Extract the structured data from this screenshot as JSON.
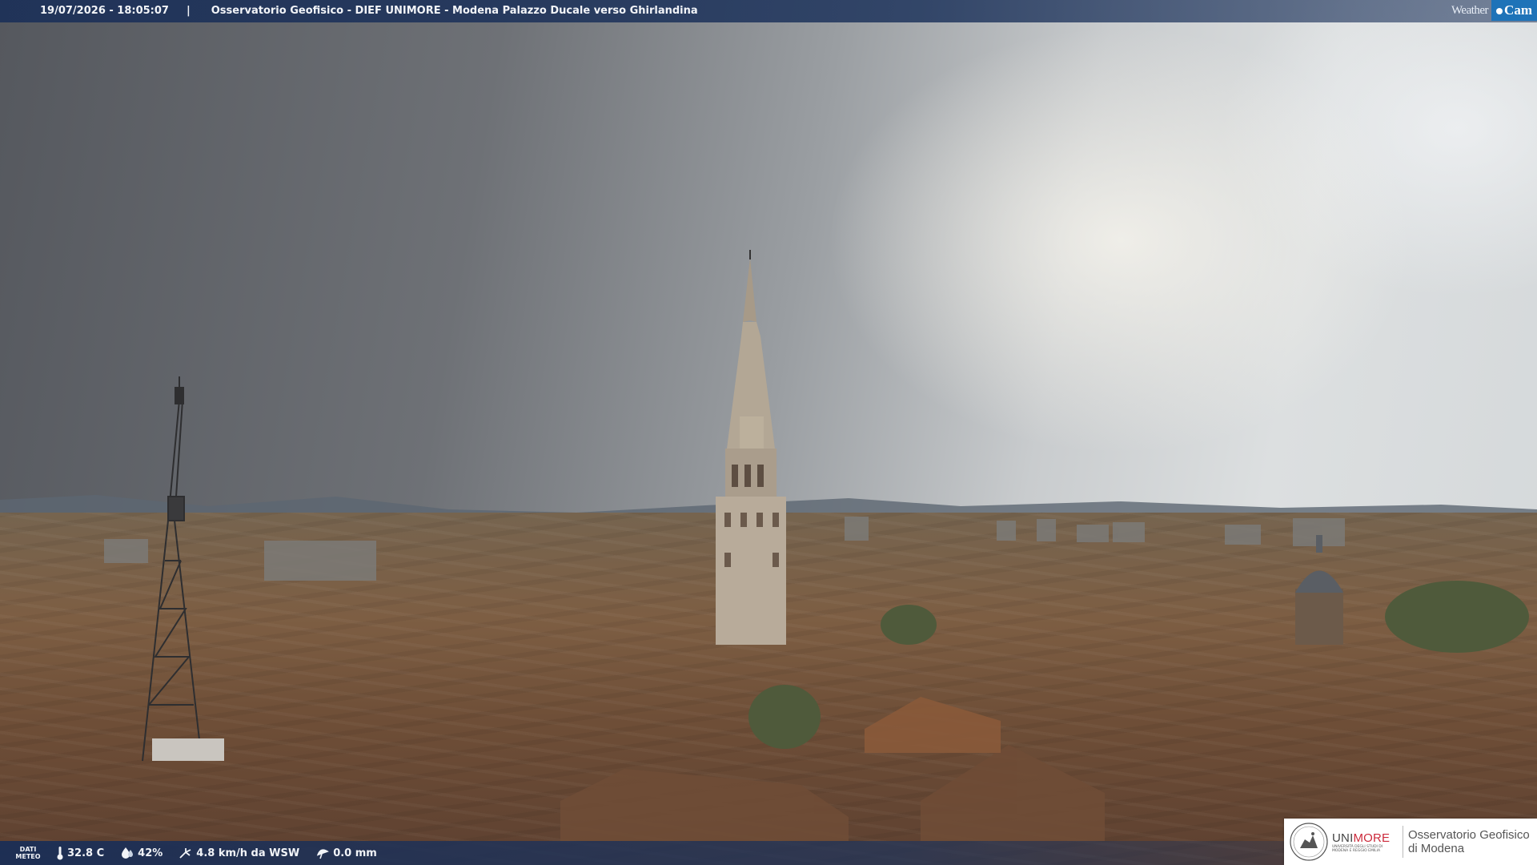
{
  "header": {
    "timestamp": "19/07/2026 - 18:05:07",
    "separator": "|",
    "title": "Osservatorio Geofisico - DIEF UNIMORE - Modena Palazzo Ducale verso Ghirlandina",
    "brand_weather": "Weather",
    "brand_cam": "Cam"
  },
  "meteo": {
    "label_line1": "DATI",
    "label_line2": "METEO",
    "temperature": "32.8 C",
    "humidity": "42%",
    "wind": "4.8 km/h da WSW",
    "rain": "0.0 mm"
  },
  "logo": {
    "unimore_uni": "UNI",
    "unimore_more": "MORE",
    "unimore_sub": "UNIVERSITÀ DEGLI STUDI DI MODENA E REGGIO EMILIA",
    "observatory_line1": "Osservatorio Geofisico",
    "observatory_line2": "di Modena"
  },
  "colors": {
    "bar": "#1c3058",
    "cam_accent": "#1e73b8",
    "unimore_red": "#cc2a3b"
  }
}
